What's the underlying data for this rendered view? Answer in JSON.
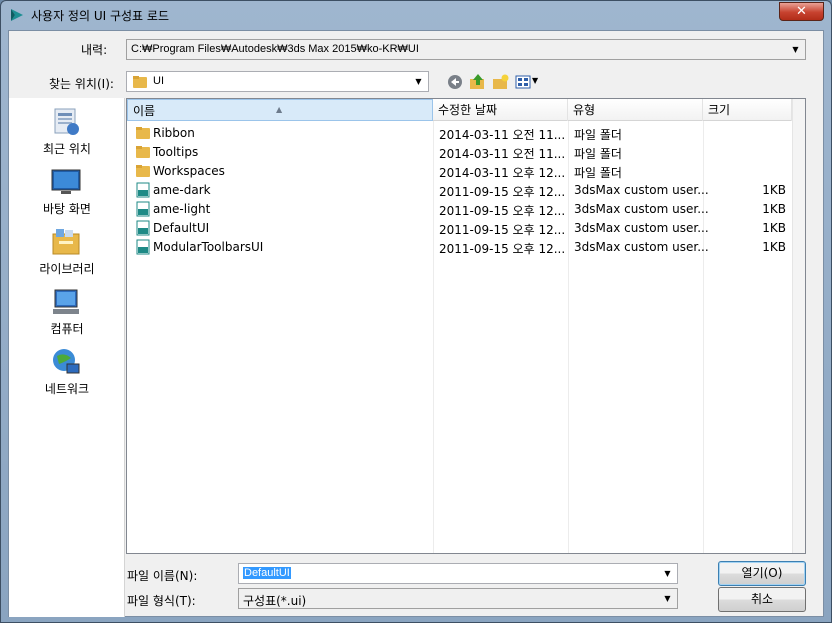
{
  "window": {
    "title": "사용자 정의 UI 구성표 로드",
    "close_label": "✕"
  },
  "history": {
    "label": "내력:",
    "value": "C:₩Program Files₩Autodesk₩3ds Max 2015₩ko-KR₩UI"
  },
  "lookin": {
    "label": "찾는 위치(I):",
    "value": "UI"
  },
  "toolbar_icons": [
    "back-icon",
    "up-folder-icon",
    "new-folder-icon",
    "view-menu-icon"
  ],
  "places": [
    {
      "label": "최근 위치",
      "icon": "recent-places-icon"
    },
    {
      "label": "바탕 화면",
      "icon": "desktop-icon"
    },
    {
      "label": "라이브러리",
      "icon": "libraries-icon"
    },
    {
      "label": "컴퓨터",
      "icon": "computer-icon"
    },
    {
      "label": "네트워크",
      "icon": "network-icon"
    }
  ],
  "columns": [
    "이름",
    "수정한 날짜",
    "유형",
    "크기"
  ],
  "files": [
    {
      "name": "Ribbon",
      "date": "2014-03-11 오전 11...",
      "type": "파일 폴더",
      "size": "",
      "kind": "folder"
    },
    {
      "name": "Tooltips",
      "date": "2014-03-11 오전 11...",
      "type": "파일 폴더",
      "size": "",
      "kind": "folder"
    },
    {
      "name": "Workspaces",
      "date": "2014-03-11 오후 12...",
      "type": "파일 폴더",
      "size": "",
      "kind": "folder"
    },
    {
      "name": "ame-dark",
      "date": "2011-09-15 오후 12...",
      "type": "3dsMax custom user...",
      "size": "1KB",
      "kind": "ui"
    },
    {
      "name": "ame-light",
      "date": "2011-09-15 오후 12...",
      "type": "3dsMax custom user...",
      "size": "1KB",
      "kind": "ui"
    },
    {
      "name": "DefaultUI",
      "date": "2011-09-15 오후 12...",
      "type": "3dsMax custom user...",
      "size": "1KB",
      "kind": "ui"
    },
    {
      "name": "ModularToolbarsUI",
      "date": "2011-09-15 오후 12...",
      "type": "3dsMax custom user...",
      "size": "1KB",
      "kind": "ui"
    }
  ],
  "filename": {
    "label": "파일 이름(N):",
    "value": "DefaultUI"
  },
  "filetype": {
    "label": "파일 형식(T):",
    "value": "구성표(*.ui)"
  },
  "buttons": {
    "open": "열기(O)",
    "cancel": "취소"
  },
  "colors": {
    "selection": "#3399ff",
    "folder": "#e8b84a",
    "ui_icon": "#1e8a86"
  }
}
